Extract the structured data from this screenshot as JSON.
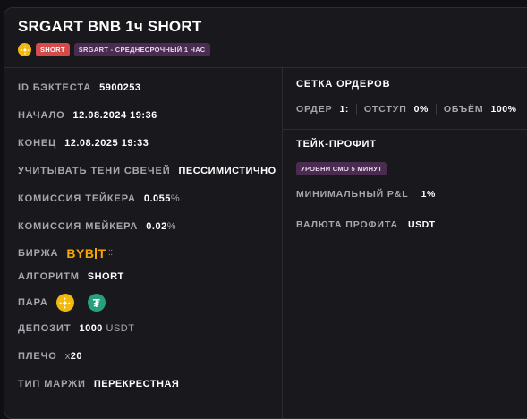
{
  "header": {
    "title": "SRGART BNB 1ч SHORT",
    "tag_short": "SHORT",
    "tag_strategy": "SRGART - СРЕДНЕСРОЧНЫЙ 1 ЧАС"
  },
  "left": {
    "backtest_id": {
      "label": "ID БЭКТЕСТА",
      "value": "5900253"
    },
    "start": {
      "label": "НАЧАЛО",
      "value": "12.08.2024 19:36"
    },
    "end": {
      "label": "КОНЕЦ",
      "value": "12.08.2025 19:33"
    },
    "shadows": {
      "label": "УЧИТЫВАТЬ ТЕНИ СВЕЧЕЙ",
      "value": "ПЕССИМИСТИЧНО"
    },
    "taker_fee": {
      "label": "КОМИССИЯ ТЕЙКЕРА",
      "value": "0.055",
      "unit": "%"
    },
    "maker_fee": {
      "label": "КОМИССИЯ МЕЙКЕРА",
      "value": "0.02",
      "unit": "%"
    },
    "exchange": {
      "label": "БИРЖА",
      "logo_left": "BYB",
      "logo_right": "T",
      "icon": "bybit-logo"
    },
    "algorithm": {
      "label": "АЛГОРИТМ",
      "value": "SHORT"
    },
    "pair": {
      "label": "ПАРА",
      "base_icon": "bnb-coin-icon",
      "quote_icon": "usdt-coin-icon",
      "quote_symbol": "₮"
    },
    "deposit": {
      "label": "ДЕПОЗИТ",
      "value": "1000",
      "unit": "USDT"
    },
    "leverage": {
      "label": "ПЛЕЧО",
      "prefix": "x",
      "value": "20"
    },
    "margin_type": {
      "label": "ТИП МАРЖИ",
      "value": "ПЕРЕКРЕСТНАЯ"
    }
  },
  "right": {
    "order_grid": {
      "title": "СЕТКА ОРДЕРОВ",
      "order_label": "ОРДЕР",
      "order_value": "1:",
      "offset_label": "ОТСТУП",
      "offset_value": "0%",
      "volume_label": "ОБЪЁМ",
      "volume_value": "100%"
    },
    "take_profit": {
      "title": "ТЕЙК-ПРОФИТ",
      "levels_tag": "УРОВНИ СМО 5 МИНУТ",
      "min_pnl_label": "МИНИМАЛЬНЫЙ P&L",
      "min_pnl_value": "1%",
      "currency_label": "ВАЛЮТА ПРОФИТА",
      "currency_value": "USDT"
    }
  },
  "colors": {
    "background": "#101014",
    "card": "#19191d",
    "short": "#d64a4a",
    "strategy_tag": "#4a2c50",
    "bnb": "#f0b90b",
    "usdt": "#26a17b",
    "bybit": "#f7a600"
  }
}
